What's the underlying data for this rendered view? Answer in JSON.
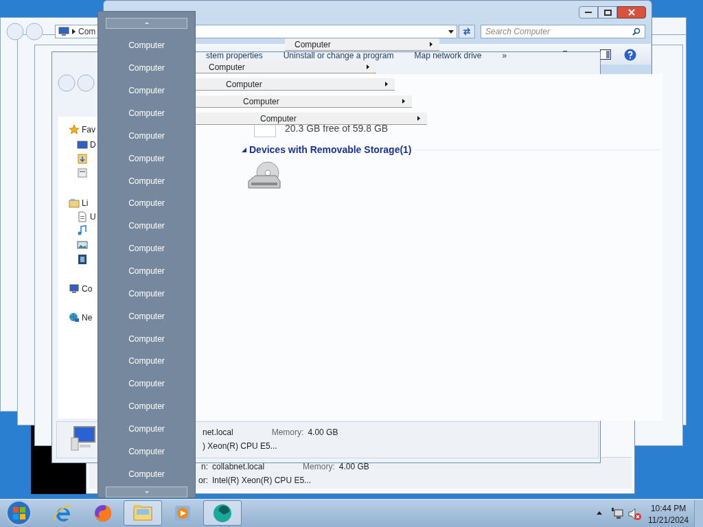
{
  "main_window": {
    "address_fragment": "Com",
    "search": {
      "placeholder": "Search Computer"
    },
    "toolbar": [
      {
        "label": "stem properties"
      },
      {
        "label": "Uninstall or change a program"
      },
      {
        "label": "Map network drive"
      },
      {
        "label": "»"
      }
    ],
    "free_space": "20.3 GB free of 59.8 GB",
    "group_heading": "Devices with Removable Storage(1)"
  },
  "nav_pane": {
    "items": [
      {
        "kind": "favorites",
        "label": "Fav"
      },
      {
        "kind": "desktop",
        "label": "D"
      },
      {
        "kind": "downloads"
      },
      {
        "kind": "places"
      },
      {
        "kind": "libraries",
        "label": "Li"
      },
      {
        "kind": "documents",
        "label": "U"
      },
      {
        "kind": "music"
      },
      {
        "kind": "pictures"
      },
      {
        "kind": "videos"
      },
      {
        "kind": "computer",
        "label": "Co"
      },
      {
        "kind": "network",
        "label": "Ne"
      }
    ]
  },
  "details_panes": [
    {
      "name": "net.local",
      "memory_label": "Memory:",
      "memory": "4.00 GB",
      "processor": ") Xeon(R) CPU E5..."
    },
    {
      "name_label": "n:",
      "name": "collabnet.local",
      "memory_label": "Memory:",
      "memory": "4.00 GB",
      "processor_label": "or:",
      "processor": "Intel(R) Xeon(R) CPU E5..."
    }
  ],
  "cascade_menu": [
    {
      "label": "Computer"
    },
    {
      "label": "Computer"
    },
    {
      "label": "Computer"
    },
    {
      "label": "Computer"
    },
    {
      "label": "Computer"
    }
  ],
  "dropdown": {
    "items": [
      {
        "label": "Computer"
      },
      {
        "label": "Computer"
      },
      {
        "label": "Computer"
      },
      {
        "label": "Computer"
      },
      {
        "label": "Computer"
      },
      {
        "label": "Computer"
      },
      {
        "label": "Computer"
      },
      {
        "label": "Computer"
      },
      {
        "label": "Computer"
      },
      {
        "label": "Computer"
      },
      {
        "label": "Computer"
      },
      {
        "label": "Computer"
      },
      {
        "label": "Computer"
      },
      {
        "label": "Computer"
      },
      {
        "label": "Computer"
      },
      {
        "label": "Computer"
      },
      {
        "label": "Computer"
      },
      {
        "label": "Computer"
      },
      {
        "label": "Computer"
      },
      {
        "label": "Computer"
      }
    ]
  },
  "taskbar": {
    "apps": [
      {
        "kind": "ie",
        "running": false
      },
      {
        "kind": "firefox",
        "running": false
      },
      {
        "kind": "explorer",
        "running": true
      },
      {
        "kind": "media",
        "running": false
      },
      {
        "kind": "app",
        "running": true
      }
    ],
    "volume_muted": true,
    "clock": {
      "time": "10:44 PM",
      "date": "11/21/2024"
    }
  }
}
